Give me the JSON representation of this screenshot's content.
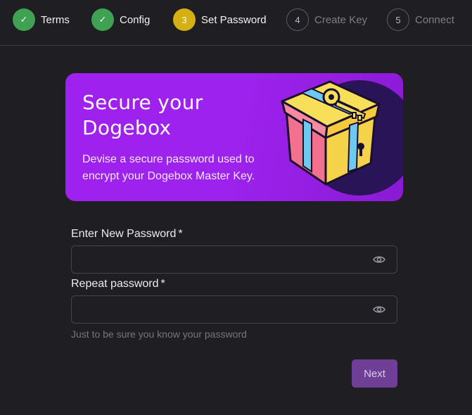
{
  "stepper": {
    "steps": [
      {
        "indicator": "✓",
        "label": "Terms",
        "state": "done"
      },
      {
        "indicator": "✓",
        "label": "Config",
        "state": "done"
      },
      {
        "indicator": "3",
        "label": "Set Password",
        "state": "active"
      },
      {
        "indicator": "4",
        "label": "Create Key",
        "state": "pending"
      },
      {
        "indicator": "5",
        "label": "Connect",
        "state": "pending"
      }
    ]
  },
  "hero": {
    "title": "Secure your Dogebox",
    "description": "Devise a secure password used to encrypt your Dogebox Master Key.",
    "icon": "treasure-chest-key"
  },
  "form": {
    "password": {
      "label": "Enter New Password",
      "required_mark": "*",
      "value": "",
      "placeholder": ""
    },
    "repeat": {
      "label": "Repeat password",
      "required_mark": "*",
      "value": "",
      "placeholder": ""
    },
    "helper": "Just to be sure you know your password",
    "toggle_icon": "eye-icon"
  },
  "actions": {
    "next_label": "Next"
  },
  "colors": {
    "background": "#1f1f23",
    "done": "#3fa152",
    "active": "#d4b012",
    "hero_purple": "#9d22ed",
    "button": "#6f3f98"
  }
}
